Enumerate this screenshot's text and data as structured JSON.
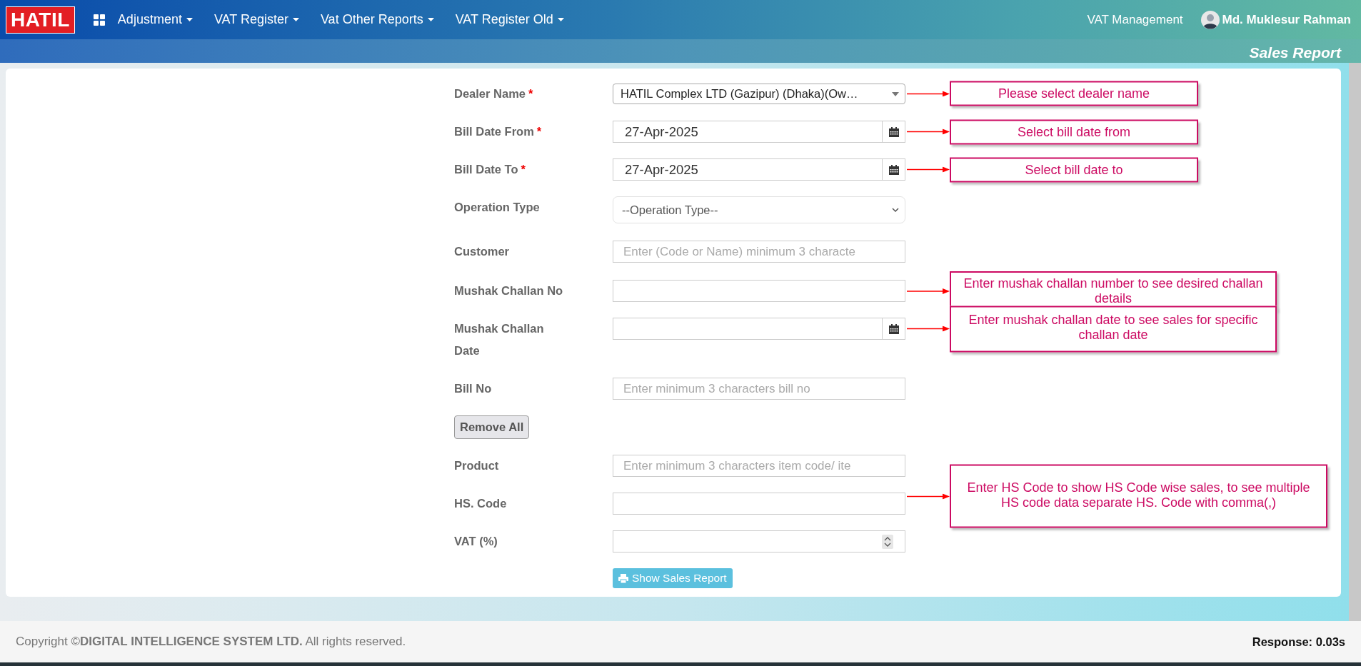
{
  "header": {
    "logo": "HATIL",
    "menus": [
      {
        "label": "Adjustment"
      },
      {
        "label": "VAT Register"
      },
      {
        "label": "Vat Other Reports"
      },
      {
        "label": "VAT Register Old"
      }
    ],
    "module": "VAT Management",
    "user": "Md. Muklesur Rahman"
  },
  "page_title": "Sales Report",
  "form": {
    "rows": [
      {
        "kind": "combo",
        "label": "Dealer Name",
        "required_mark": "*",
        "value": "HATIL Complex LTD (Gazipur) (Dhaka)(Ow…",
        "note": "Please select dealer name"
      },
      {
        "kind": "date",
        "label": "Bill Date From",
        "required_mark": "*",
        "value": "27-Apr-2025",
        "note": "Select bill date from"
      },
      {
        "kind": "date",
        "label": "Bill Date To",
        "required_mark": "*",
        "value": "27-Apr-2025",
        "note": "Select bill date to"
      },
      {
        "kind": "select",
        "label": "Operation Type",
        "value": "--Operation Type--"
      },
      {
        "kind": "text",
        "label": "Customer",
        "placeholder": "Enter (Code or Name) minimum 3 characte"
      },
      {
        "kind": "text",
        "label": "Mushak Challan No",
        "note": "Enter mushak challan number to see desired challan details"
      },
      {
        "kind": "date",
        "label": "Mushak Challan Date",
        "note": "Enter mushak challan date to see sales for specific challan date"
      },
      {
        "kind": "text",
        "label": "Bill No",
        "placeholder": "Enter minimum 3 characters bill no"
      },
      {
        "kind": "action",
        "label": "Remove All"
      },
      {
        "kind": "text",
        "label": "Product",
        "placeholder": "Enter minimum 3 characters item code/ ite"
      },
      {
        "kind": "text",
        "label": "HS. Code",
        "note": "Enter HS Code to show HS Code wise sales, to see multiple HS code data separate HS. Code with comma(,)"
      },
      {
        "kind": "number",
        "label": "VAT (%)"
      }
    ],
    "submit": "Show Sales Report"
  },
  "footer": {
    "copyright": "Copyright ©**DIGITAL INTELLIGENCE SYSTEM LTD.** All rights reserved.",
    "response": "Response: 0.03s"
  }
}
